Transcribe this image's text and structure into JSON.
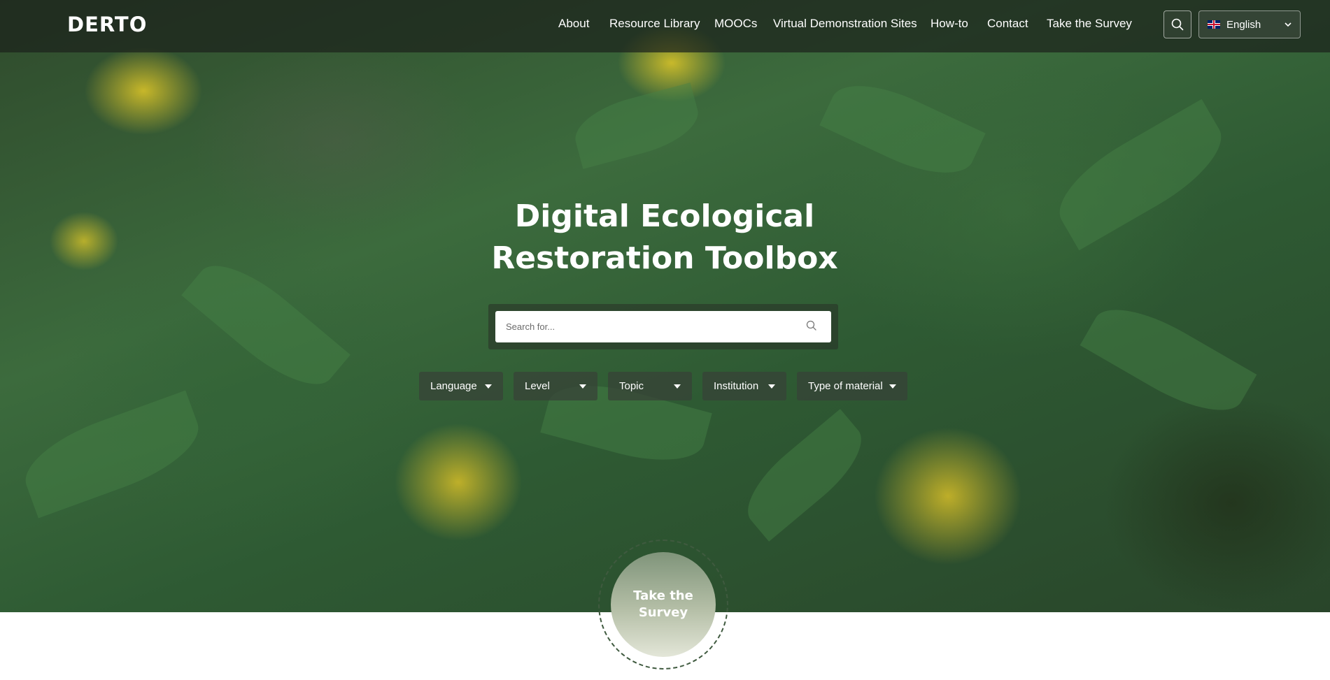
{
  "header": {
    "logo": "DERTO",
    "nav": [
      "About",
      "Resource Library",
      "MOOCs",
      "Virtual Demonstration Sites",
      "How-to",
      "Contact",
      "Take the Survey"
    ],
    "search_icon": "search-icon",
    "language": {
      "selected": "English",
      "flag_icon": "uk-flag-icon",
      "chevron_icon": "chevron-down-icon"
    }
  },
  "hero": {
    "title_line1": "Digital Ecological",
    "title_line2": "Restoration Toolbox",
    "search": {
      "placeholder": "Search for...",
      "icon": "search-icon"
    },
    "filters": [
      "Language",
      "Level",
      "Topic",
      "Institution",
      "Type of material"
    ]
  },
  "survey_cta": {
    "label": "Take the Survey"
  },
  "colors": {
    "header_bg": "#1c221c",
    "accent_green": "#3f5a3f",
    "text": "#ffffff"
  }
}
